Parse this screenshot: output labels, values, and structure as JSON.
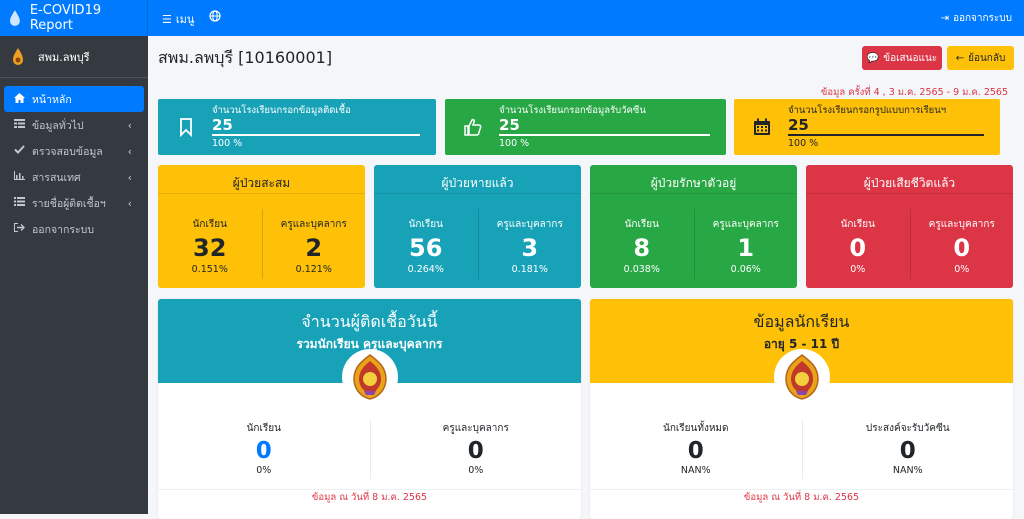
{
  "app": {
    "title": "E-COVID19 Report",
    "menu_label": "เมนู",
    "logout_label": "ออกจากระบบ"
  },
  "user": {
    "name": "สพม.ลพบุรี"
  },
  "sidebar": {
    "items": [
      {
        "label": "หน้าหลัก",
        "icon": "home-icon",
        "active": true
      },
      {
        "label": "ข้อมูลทั่วไป",
        "icon": "table-icon",
        "chevron": "‹"
      },
      {
        "label": "ตรวจสอบข้อมูล",
        "icon": "check-icon",
        "chevron": "‹"
      },
      {
        "label": "สารสนเทศ",
        "icon": "chart-icon",
        "chevron": "‹"
      },
      {
        "label": "รายชื่อผู้ติดเชื้อฯ",
        "icon": "list-icon",
        "chevron": "‹"
      },
      {
        "label": "ออกจากระบบ",
        "icon": "logout-icon"
      }
    ]
  },
  "page": {
    "title": "สพม.ลพบุรี [10160001]",
    "feedback_label": "ข้อเสนอแนะ",
    "back_label": "ย้อนกลับ",
    "data_range": "ข้อมูล ครั้งที่ 4 , 3 ม.ค. 2565 - 9 ม.ค. 2565"
  },
  "info_boxes": [
    {
      "label": "จำนวนโรงเรียนกรอกข้อมูลติดเชื้อ",
      "value": "25",
      "percent": "100 %",
      "color": "#17a2b8",
      "icon": "bookmark-icon"
    },
    {
      "label": "จำนวนโรงเรียนกรอกข้อมูลรับวัคซีน",
      "value": "25",
      "percent": "100 %",
      "color": "#28a745",
      "icon": "thumbs-up-icon"
    },
    {
      "label": "จำนวนโรงเรียนกรอกรูปแบบการเรียนฯ",
      "value": "25",
      "percent": "100 %",
      "color": "#ffc107",
      "icon": "calendar-icon"
    }
  ],
  "stat_boxes": [
    {
      "title": "ผู้ป่วยสะสม",
      "color": "#ffc107",
      "dark": true,
      "students_label": "นักเรียน",
      "students": "32",
      "students_pct": "0.151%",
      "staff_label": "ครูและบุคลากร",
      "staff": "2",
      "staff_pct": "0.121%"
    },
    {
      "title": "ผู้ป่วยหายแล้ว",
      "color": "#17a2b8",
      "dark": false,
      "students_label": "นักเรียน",
      "students": "56",
      "students_pct": "0.264%",
      "staff_label": "ครูและบุคลากร",
      "staff": "3",
      "staff_pct": "0.181%"
    },
    {
      "title": "ผู้ป่วยรักษาตัวอยู่",
      "color": "#28a745",
      "dark": false,
      "students_label": "นักเรียน",
      "students": "8",
      "students_pct": "0.038%",
      "staff_label": "ครูและบุคลากร",
      "staff": "1",
      "staff_pct": "0.06%"
    },
    {
      "title": "ผู้ป่วยเสียชีวิตแล้ว",
      "color": "#dc3545",
      "dark": false,
      "students_label": "นักเรียน",
      "students": "0",
      "students_pct": "0%",
      "staff_label": "ครูและบุคลากร",
      "staff": "0",
      "staff_pct": "0%"
    }
  ],
  "cards": [
    {
      "title": "จำนวนผู้ติดเชื้อวันนี้",
      "subtitle": "รวมนักเรียน ครูและบุคลากร",
      "color": "#17a2b8",
      "dark": false,
      "left_label": "นักเรียน",
      "left_value": "0",
      "left_pct": "0%",
      "left_color": "#007bff",
      "right_label": "ครูและบุคลากร",
      "right_value": "0",
      "right_pct": "0%",
      "footer": "ข้อมูล ณ วันที่ 8 ม.ค. 2565"
    },
    {
      "title": "ข้อมูลนักเรียน",
      "subtitle": "อายุ 5 - 11 ปี",
      "color": "#ffc107",
      "dark": true,
      "left_label": "นักเรียนทั้งหมด",
      "left_value": "0",
      "left_pct": "NAN%",
      "left_color": "#212529",
      "right_label": "ประสงค์จะรับวัคซีน",
      "right_value": "0",
      "right_pct": "NAN%",
      "footer": "ข้อมูล ณ วันที่ 8 ม.ค. 2565"
    }
  ]
}
